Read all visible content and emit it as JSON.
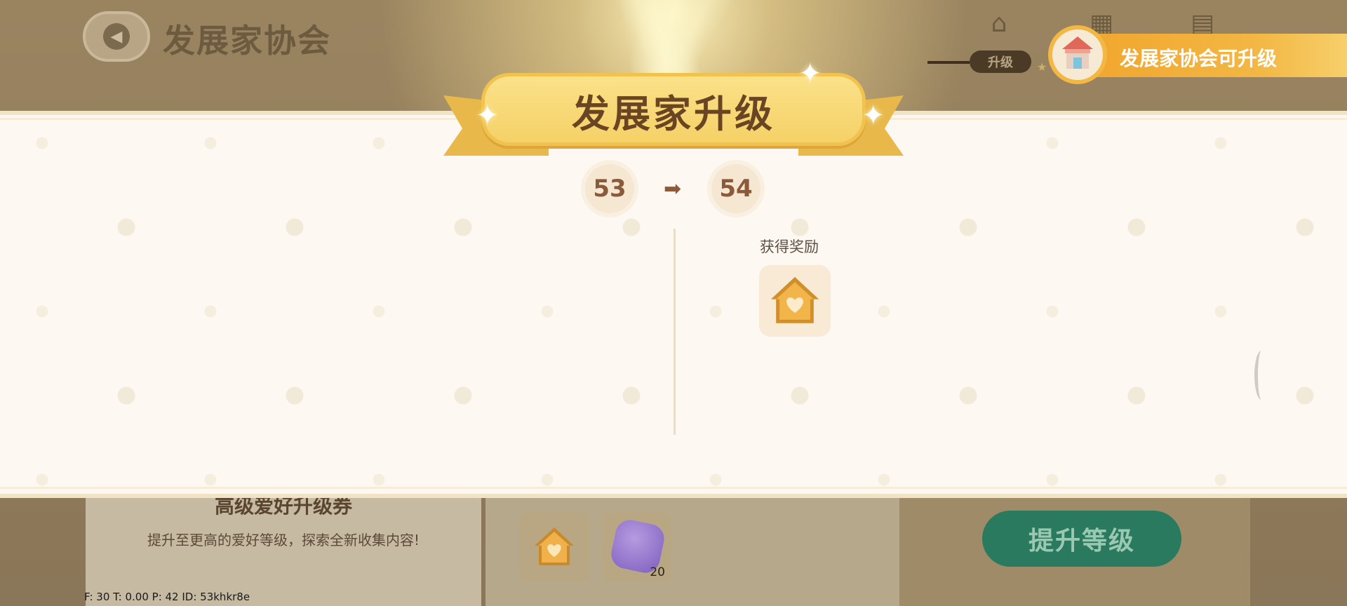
{
  "header": {
    "back_icon": "chevron-left-icon",
    "title": "发展家协会",
    "tab_label": "升级",
    "icons": [
      "home-icon",
      "grid-icon",
      "card-icon"
    ]
  },
  "notification": {
    "text": "发展家协会可升级",
    "icon": "shop-house-icon"
  },
  "modal": {
    "title": "发展家升级",
    "level_from": "53",
    "level_to": "54",
    "arrow_icon": "arrow-right-icon",
    "reward_title": "获得奖励",
    "rewards": [
      {
        "icon": "heart-house-icon"
      }
    ]
  },
  "background_panel": {
    "title": "高级爱好升级券",
    "subtitle": "提升至更高的爱好等级，探索全新收集内容!",
    "items": [
      {
        "icon": "heart-house-icon",
        "count": ""
      },
      {
        "icon": "purple-star-icon",
        "count": "20"
      }
    ],
    "upgrade_button": "提升等级"
  },
  "debug": "F: 30    T: 0.00    P: 42    ID: 53khkr8e",
  "colors": {
    "ribbon": "#f5d167",
    "title_text": "#6a4523",
    "button": "#2a7a60",
    "banner": "#f0a32a"
  }
}
